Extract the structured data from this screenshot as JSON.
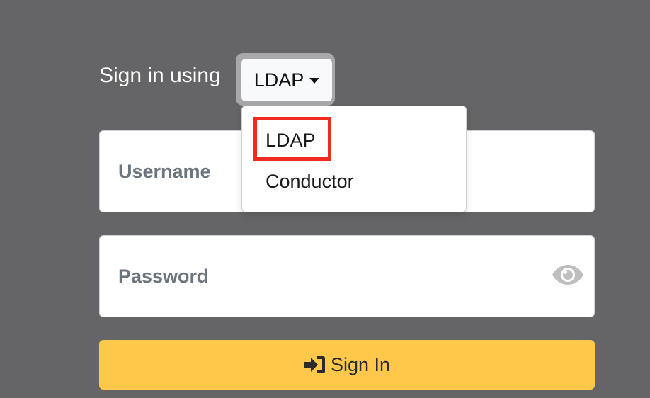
{
  "login": {
    "sign_in_using_label": "Sign in using",
    "method_selected": "LDAP",
    "method_options": [
      "LDAP",
      "Conductor"
    ],
    "username_placeholder": "Username",
    "password_placeholder": "Password",
    "sign_in_label": "Sign In"
  },
  "icons": {
    "caret": "chevron-down-icon",
    "password_toggle": "eye-icon",
    "sign_in": "sign-in-icon"
  },
  "colors": {
    "background": "#656567",
    "primary_button": "#ffc84a",
    "highlight": "#ee2a1c",
    "placeholder_text": "#6c757d"
  }
}
